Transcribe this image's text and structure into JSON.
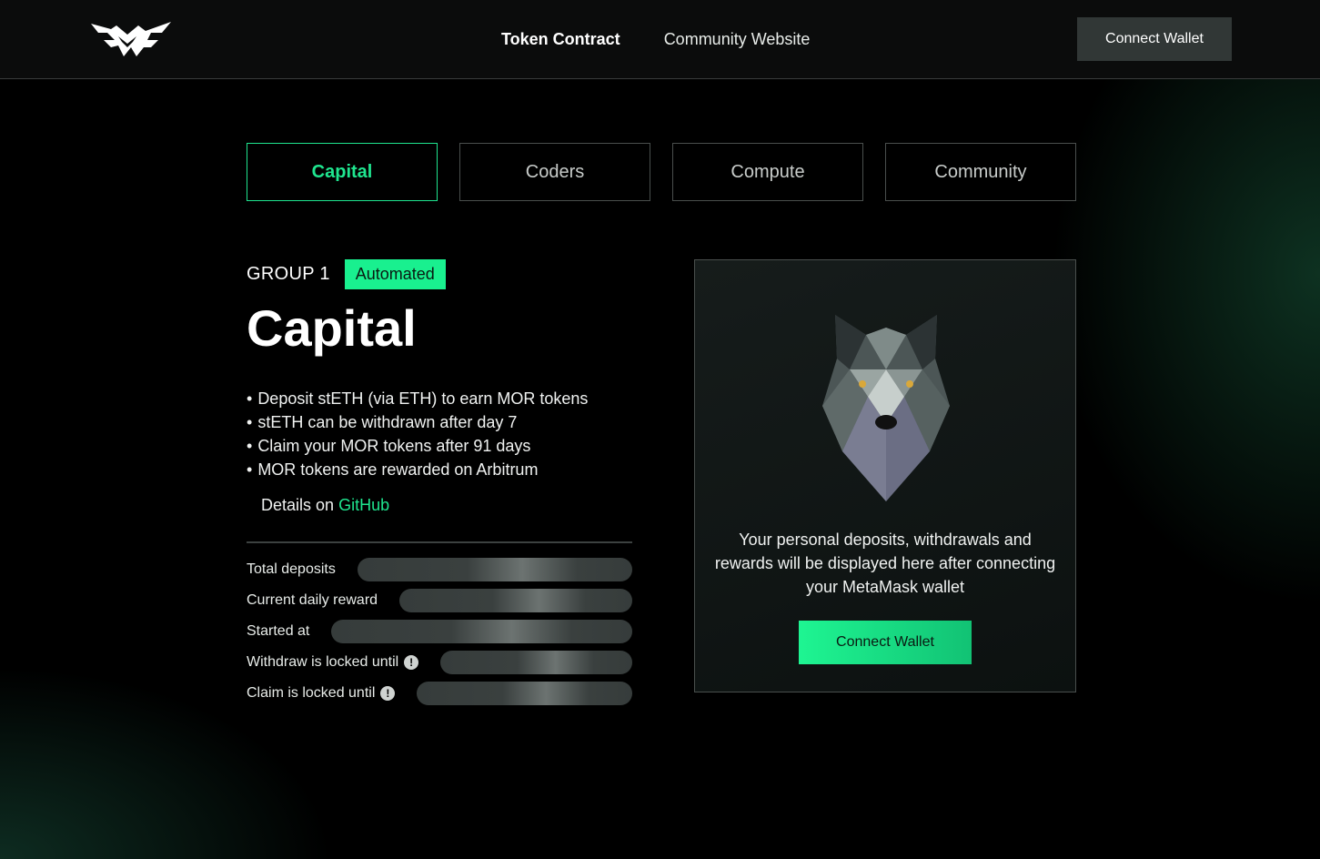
{
  "header": {
    "logo": "mor-logo-icon",
    "nav": [
      "Token Contract",
      "Community Website"
    ],
    "connect_label": "Connect Wallet"
  },
  "tabs": [
    "Capital",
    "Coders",
    "Compute",
    "Community"
  ],
  "active_tab": "Capital",
  "group": {
    "label": "GROUP 1",
    "badge": "Automated"
  },
  "title": "Capital",
  "bullets": [
    "Deposit stETH (via ETH) to earn MOR tokens",
    "stETH can be withdrawn after day 7",
    "Claim your MOR tokens after 91 days",
    "MOR tokens are rewarded on Arbitrum"
  ],
  "details": {
    "prefix": "Details on",
    "link": "GitHub"
  },
  "stats": [
    {
      "label": "Total deposits",
      "info": false
    },
    {
      "label": "Current daily reward",
      "info": false
    },
    {
      "label": "Started at",
      "info": false
    },
    {
      "label": "Withdraw is locked until",
      "info": true
    },
    {
      "label": "Claim is locked until",
      "info": true
    }
  ],
  "card": {
    "image": "wolf-icon",
    "text": "Your personal deposits, withdrawals and rewards will be displayed here after connecting your MetaMask wallet",
    "button": "Connect Wallet"
  },
  "colors": {
    "accent": "#1fe58f",
    "badge_bg": "#19f08f",
    "header_bg": "#0b0c0c"
  }
}
